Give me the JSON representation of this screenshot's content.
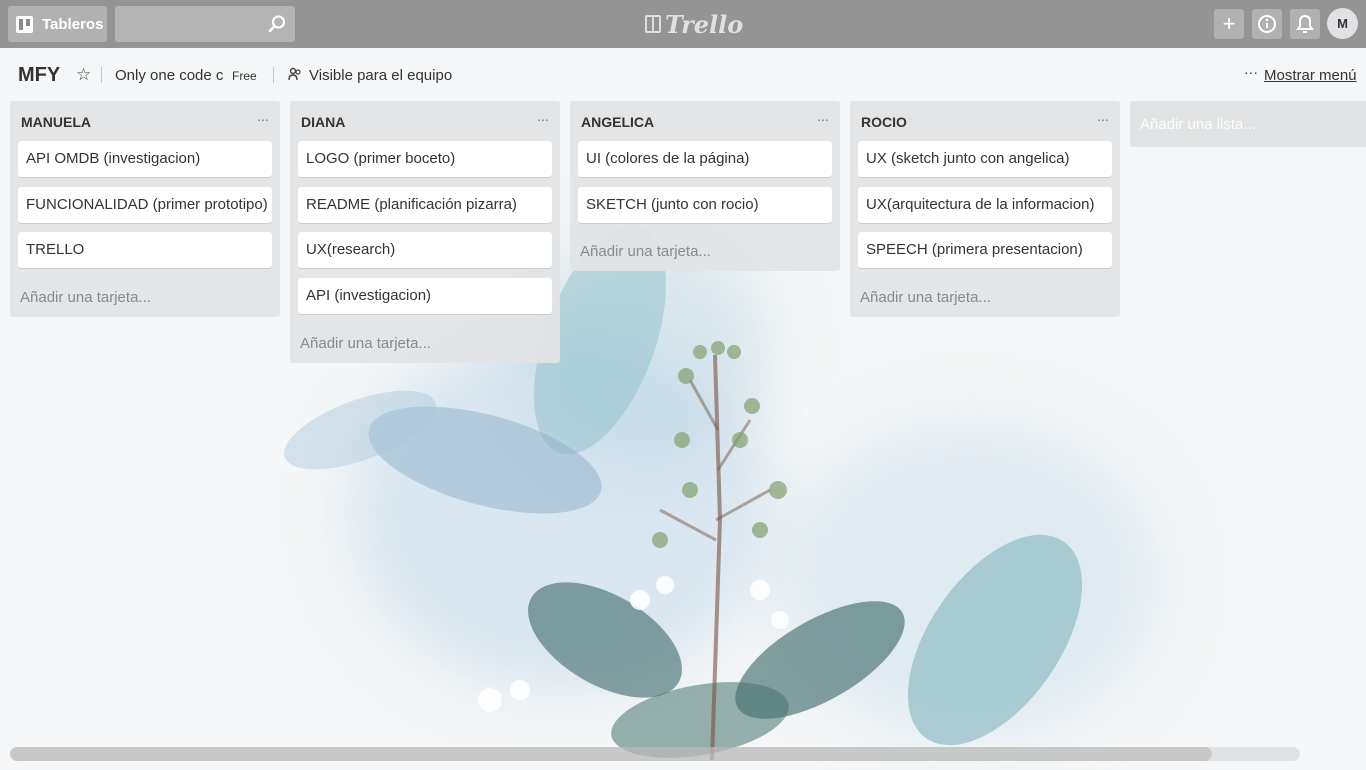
{
  "topbar": {
    "boards_label": "Tableros",
    "search_value": "",
    "logo_text": "Trello",
    "add_symbol": "+",
    "info_symbol": "i",
    "avatar_initial": "M"
  },
  "board": {
    "title": "MFY",
    "team": "Only one code c",
    "plan": "Free",
    "visibility": "Visible para el equipo",
    "show_menu": "Mostrar menú",
    "menu_dots": "···"
  },
  "lists": [
    {
      "title": "MANUELA",
      "menu": "···",
      "cards": [
        "API OMDB (investigacion)",
        "FUNCIONALIDAD (primer prototipo)",
        "TRELLO"
      ],
      "add_card": "Añadir una tarjeta..."
    },
    {
      "title": "DIANA",
      "menu": "···",
      "cards": [
        "LOGO (primer boceto)",
        "README (planificación pizarra)",
        "UX(research)",
        "API (investigacion)"
      ],
      "add_card": "Añadir una tarjeta..."
    },
    {
      "title": "ANGELICA",
      "menu": "···",
      "cards": [
        "UI (colores de la página)",
        "SKETCH (junto con rocio)"
      ],
      "add_card": "Añadir una tarjeta..."
    },
    {
      "title": "ROCIO",
      "menu": "···",
      "cards": [
        "UX (sketch junto con angelica)",
        "UX(arquitectura de la informacion)",
        "SPEECH (primera presentacion)"
      ],
      "add_card": "Añadir una tarjeta..."
    }
  ],
  "add_list": "Añadir una lista...",
  "icons": [
    "boards-icon",
    "search-icon",
    "trello-logo-icon",
    "add-icon",
    "info-icon",
    "notification-bell-icon",
    "star-icon",
    "team-visibility-icon",
    "menu-dots-icon"
  ],
  "colors": {
    "topbar": "#787878",
    "list_bg": "#e2e4e6",
    "card_bg": "#ffffff",
    "add_card_text": "#838c91"
  }
}
